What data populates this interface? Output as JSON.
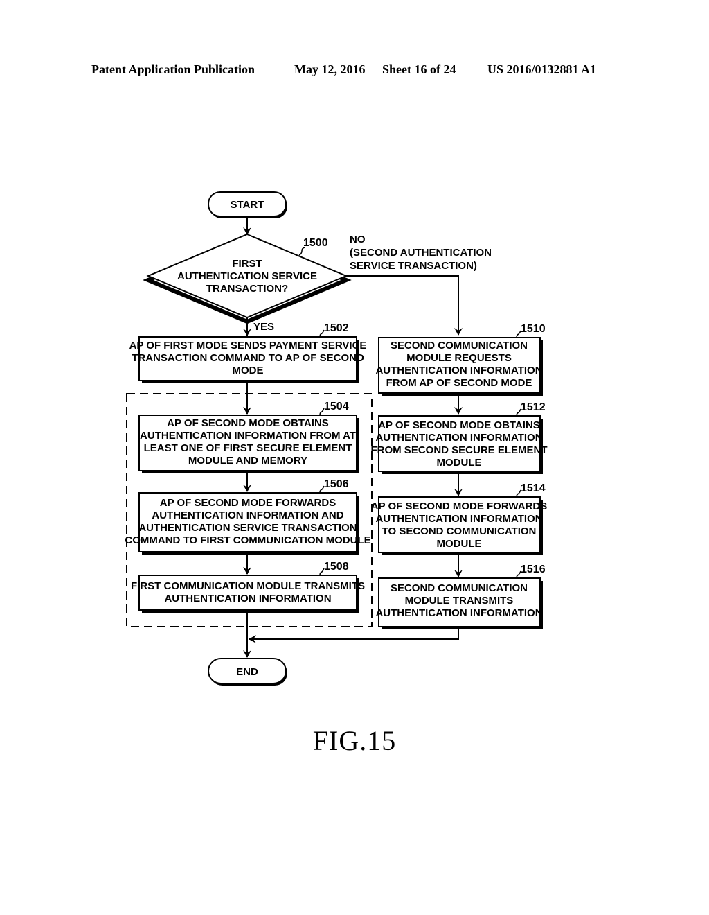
{
  "header": {
    "left": "Patent Application Publication",
    "date": "May 12, 2016",
    "sheet": "Sheet 16 of 24",
    "number": "US 2016/0132881 A1"
  },
  "flowchart": {
    "start": "START",
    "end": "END",
    "decision": {
      "ref": "1500",
      "lines": [
        "FIRST",
        "AUTHENTICATION SERVICE",
        "TRANSACTION?"
      ],
      "yes_label": "YES",
      "no_label": [
        "NO",
        "(SECOND AUTHENTICATION",
        "SERVICE TRANSACTION)"
      ]
    },
    "steps": {
      "s1502": {
        "ref": "1502",
        "lines": [
          "AP OF FIRST MODE SENDS PAYMENT SERVICE",
          "TRANSACTION COMMAND TO AP OF SECOND",
          "MODE"
        ]
      },
      "s1504": {
        "ref": "1504",
        "lines": [
          "AP OF SECOND MODE OBTAINS",
          "AUTHENTICATION INFORMATION FROM AT",
          "LEAST ONE OF FIRST SECURE ELEMENT",
          "MODULE AND MEMORY"
        ]
      },
      "s1506": {
        "ref": "1506",
        "lines": [
          "AP OF SECOND MODE FORWARDS",
          "AUTHENTICATION INFORMATION AND",
          "AUTHENTICATION SERVICE TRANSACTION",
          "COMMAND TO FIRST COMMUNICATION MODULE"
        ]
      },
      "s1508": {
        "ref": "1508",
        "lines": [
          "FIRST COMMUNICATION MODULE TRANSMITS",
          "AUTHENTICATION INFORMATION"
        ]
      },
      "s1510": {
        "ref": "1510",
        "lines": [
          "SECOND COMMUNICATION",
          "MODULE REQUESTS",
          "AUTHENTICATION INFORMATION",
          "FROM AP OF SECOND MODE"
        ]
      },
      "s1512": {
        "ref": "1512",
        "lines": [
          "AP OF SECOND MODE OBTAINS",
          "AUTHENTICATION INFORMATION",
          "FROM SECOND SECURE ELEMENT",
          "MODULE"
        ]
      },
      "s1514": {
        "ref": "1514",
        "lines": [
          "AP OF SECOND MODE FORWARDS",
          "AUTHENTICATION INFORMATION",
          "TO SECOND COMMUNICATION",
          "MODULE"
        ]
      },
      "s1516": {
        "ref": "1516",
        "lines": [
          "SECOND COMMUNICATION",
          "MODULE TRANSMITS",
          "AUTHENTICATION INFORMATION"
        ]
      }
    }
  },
  "figure_label": "FIG.15"
}
